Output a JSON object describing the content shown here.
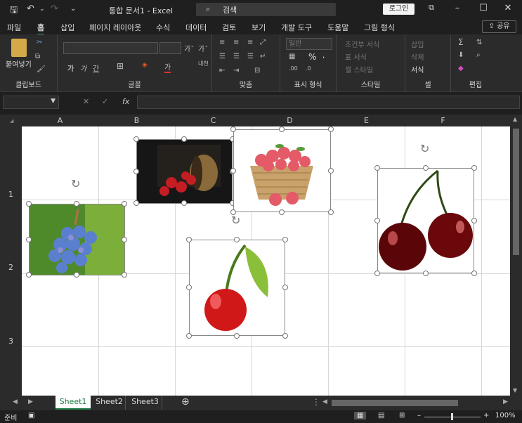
{
  "titlebar": {
    "title": "통합 문서1  -  Excel",
    "search_label": "검색",
    "login": "로그인",
    "undo": "↶",
    "redo": "↷",
    "save_icon": "save-icon"
  },
  "menu": [
    "파일",
    "홈",
    "삽입",
    "페이지 레이아웃",
    "수식",
    "데이터",
    "검토",
    "보기",
    "개발 도구",
    "도움말",
    "그림 형식"
  ],
  "share": "공유",
  "ribbon": {
    "clipboard": {
      "paste": "붙여넣기",
      "label": "클립보드"
    },
    "font": {
      "label": "글꼴",
      "grow": "가ˆ",
      "shrink": "가ˇ",
      "bold": "가",
      "italic": "가",
      "underline": "간",
      "color": "가"
    },
    "align": {
      "label": "맞춤"
    },
    "number": {
      "label": "표시 형식",
      "format": "일반",
      "percent": "%"
    },
    "styles": {
      "label": "스타일",
      "cond": "조건부 서식",
      "table": "표 서식",
      "cell": "셀 스타일"
    },
    "cells": {
      "label": "셀",
      "insert": "삽입",
      "delete": "삭제",
      "format": "서식"
    },
    "edit": {
      "label": "편집",
      "sum": "Σ"
    }
  },
  "formula": {
    "fx": "fx",
    "cancel": "✕",
    "enter": "✓"
  },
  "columns": [
    "A",
    "B",
    "C",
    "D",
    "E",
    "F"
  ],
  "rows": [
    "1",
    "2",
    "3"
  ],
  "sheets": [
    "Sheet1",
    "Sheet2",
    "Sheet3"
  ],
  "status": {
    "ready": "준비",
    "zoom": "100%"
  }
}
